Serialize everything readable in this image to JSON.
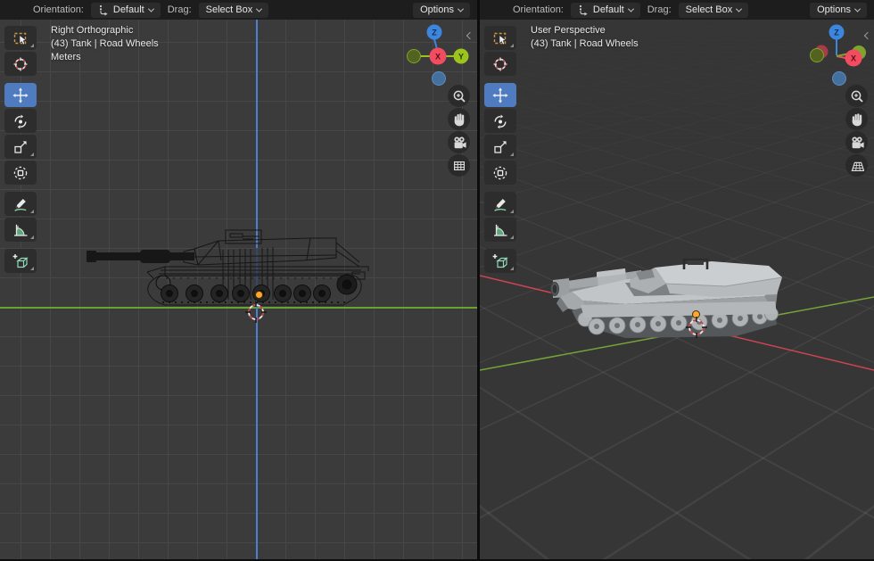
{
  "colors": {
    "accent_blue": "#4f7cc0",
    "header_bg": "#1d1d1d",
    "viewport_bg_left": "#3b3b3b",
    "viewport_bg_right": "#363636",
    "grid_line": "#474747",
    "axis_x_red": "#f14c5f",
    "axis_y_green": "#9bc41f",
    "axis_z_blue": "#3d86dd",
    "axis_y_negative": "#53631f",
    "axis_z_negative": "#44709e",
    "floor_line_green": "#67a52f",
    "floor_line_blue": "#4d7fd0",
    "persp_axis_red": "#cc4452",
    "persp_axis_green": "#75a339",
    "origin_orange": "#ffa72e"
  },
  "panes": [
    {
      "header": {
        "orientation_label": "Orientation:",
        "orientation_value": "Default",
        "drag_label": "Drag:",
        "drag_value": "Select Box",
        "options_label": "Options"
      },
      "overlay": {
        "view_name": "Right Orthographic",
        "object_info": "(43) Tank | Road Wheels",
        "units": "Meters"
      },
      "gizmo": {
        "x": "X",
        "y": "Y",
        "z": "Z"
      }
    },
    {
      "header": {
        "orientation_label": "Orientation:",
        "orientation_value": "Default",
        "drag_label": "Drag:",
        "drag_value": "Select Box",
        "options_label": "Options"
      },
      "overlay": {
        "view_name": "User Perspective",
        "object_info": "(43) Tank | Road Wheels"
      },
      "gizmo": {
        "x": "X",
        "z": "Z"
      }
    }
  ],
  "toolbar": {
    "tools": [
      {
        "name": "select-box-tool",
        "active": false
      },
      {
        "name": "cursor-tool",
        "active": false
      },
      {
        "name": "move-tool",
        "active": true
      },
      {
        "name": "rotate-tool",
        "active": false
      },
      {
        "name": "scale-tool",
        "active": false
      },
      {
        "name": "transform-tool",
        "active": false
      },
      {
        "name": "annotate-tool",
        "active": false
      },
      {
        "name": "measure-tool",
        "active": false
      },
      {
        "name": "add-cube-tool",
        "active": false
      }
    ]
  },
  "nav_buttons_left": [
    "zoom",
    "pan",
    "camera-view",
    "orthographic-grid"
  ],
  "nav_buttons_right": [
    "zoom",
    "pan",
    "camera-view",
    "perspective-grid"
  ]
}
